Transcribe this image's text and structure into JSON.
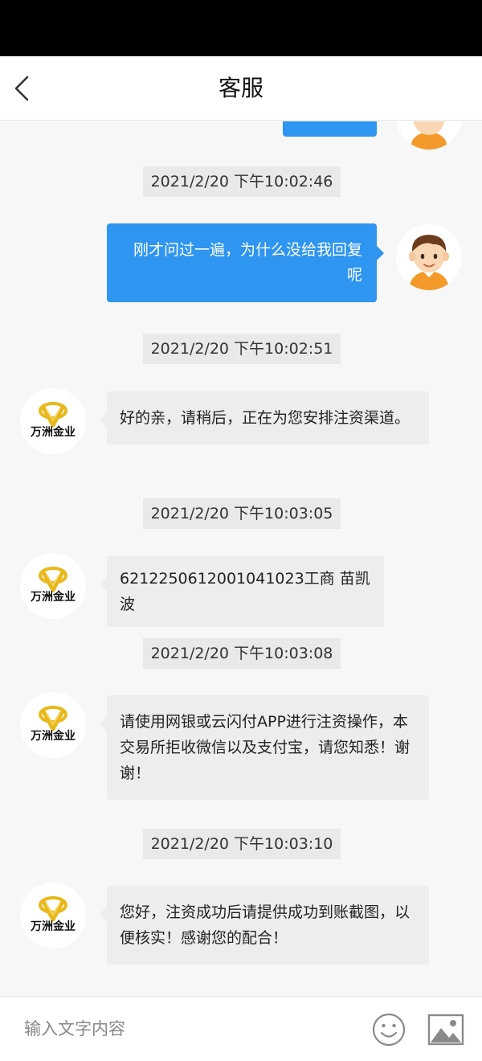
{
  "header": {
    "title": "客服",
    "back_icon": "back-arrow-icon"
  },
  "messages": [
    {
      "timestamp": "2021/2/20 下午10:02:46",
      "sender": "user",
      "text": "刚才问过一遍，为什么没给我回复呢"
    },
    {
      "timestamp": "2021/2/20 下午10:02:51",
      "sender": "service",
      "text": "好的亲，请稍后，正在为您安排注资渠道。"
    },
    {
      "timestamp": "2021/2/20 下午10:03:05",
      "sender": "service",
      "text": "6212250612001041023工商 苗凯波"
    },
    {
      "timestamp": "2021/2/20 下午10:03:08",
      "sender": "service",
      "text": "请使用网银或云闪付APP进行注资操作，本交易所拒收微信以及支付宝，请您知悉！谢谢！"
    },
    {
      "timestamp": "2021/2/20 下午10:03:10",
      "sender": "service",
      "text": "您好，注资成功后请提供成功到账截图，以便核实！感谢您的配合！"
    }
  ],
  "service_avatar_name": "万洲金业",
  "input": {
    "placeholder": "输入文字内容",
    "value": ""
  },
  "icons": {
    "emoji": "emoji-icon",
    "image": "image-icon"
  },
  "colors": {
    "accent": "#2e95f0",
    "logo_gold": "#e8b81c"
  }
}
